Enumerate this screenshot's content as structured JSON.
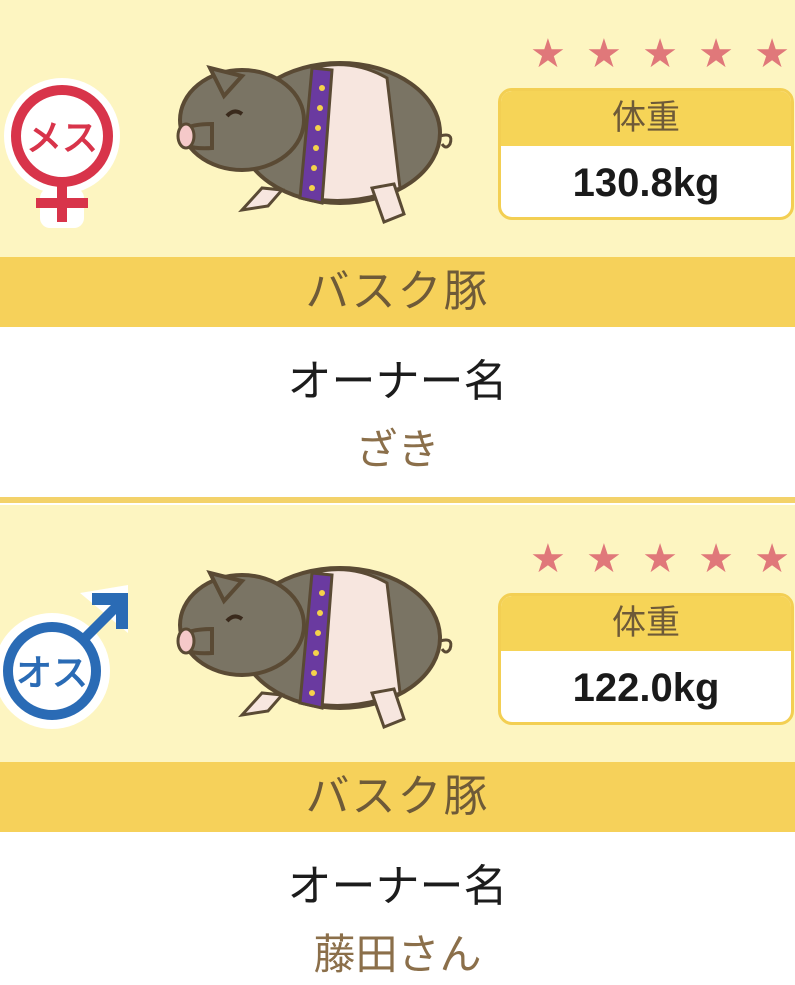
{
  "cards": [
    {
      "gender_label": "メス",
      "gender_color": "#d8344a",
      "stars": [
        "★",
        "★",
        "★",
        "★",
        "★"
      ],
      "weight_label": "体重",
      "weight_value": "130.8kg",
      "breed": "バスク豚",
      "owner_label": "オーナー名",
      "owner_name": "ざき"
    },
    {
      "gender_label": "オス",
      "gender_color": "#2a6bb5",
      "stars": [
        "★",
        "★",
        "★",
        "★",
        "★"
      ],
      "weight_label": "体重",
      "weight_value": "122.0kg",
      "breed": "バスク豚",
      "owner_label": "オーナー名",
      "owner_name": "藤田さん"
    }
  ],
  "colors": {
    "panel_bg": "#fdf5c1",
    "accent_yellow": "#f6d15a",
    "star_pink": "#e0787a",
    "brown_text": "#6e5a38"
  }
}
